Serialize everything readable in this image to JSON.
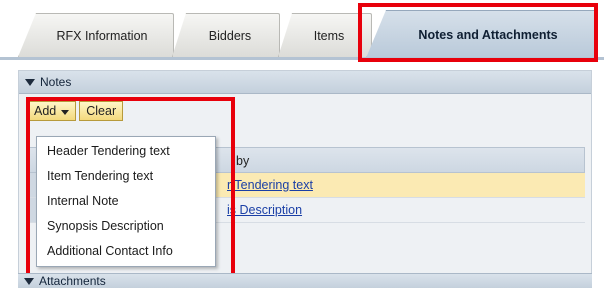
{
  "tabs": [
    {
      "label": "RFX Information"
    },
    {
      "label": "Bidders"
    },
    {
      "label": "Items"
    },
    {
      "label": "Notes and Attachments",
      "active": true
    }
  ],
  "notes_panel": {
    "title": "Notes",
    "add_label": "Add",
    "clear_label": "Clear",
    "column_header": "by",
    "rows": [
      {
        "link": "r Tendering text"
      },
      {
        "link": "is Description"
      }
    ]
  },
  "add_menu": {
    "items": [
      "Header Tendering text",
      "Item Tendering text",
      "Internal Note",
      "Synopsis Description",
      "Additional Contact Info"
    ]
  },
  "attachments_panel": {
    "title": "Attachments"
  },
  "colors": {
    "highlight": "#e8000b",
    "active_tab": "#c4d3e2",
    "button": "#f3d97d",
    "selected_row": "#fbeab3",
    "link": "#1a3fa6"
  }
}
